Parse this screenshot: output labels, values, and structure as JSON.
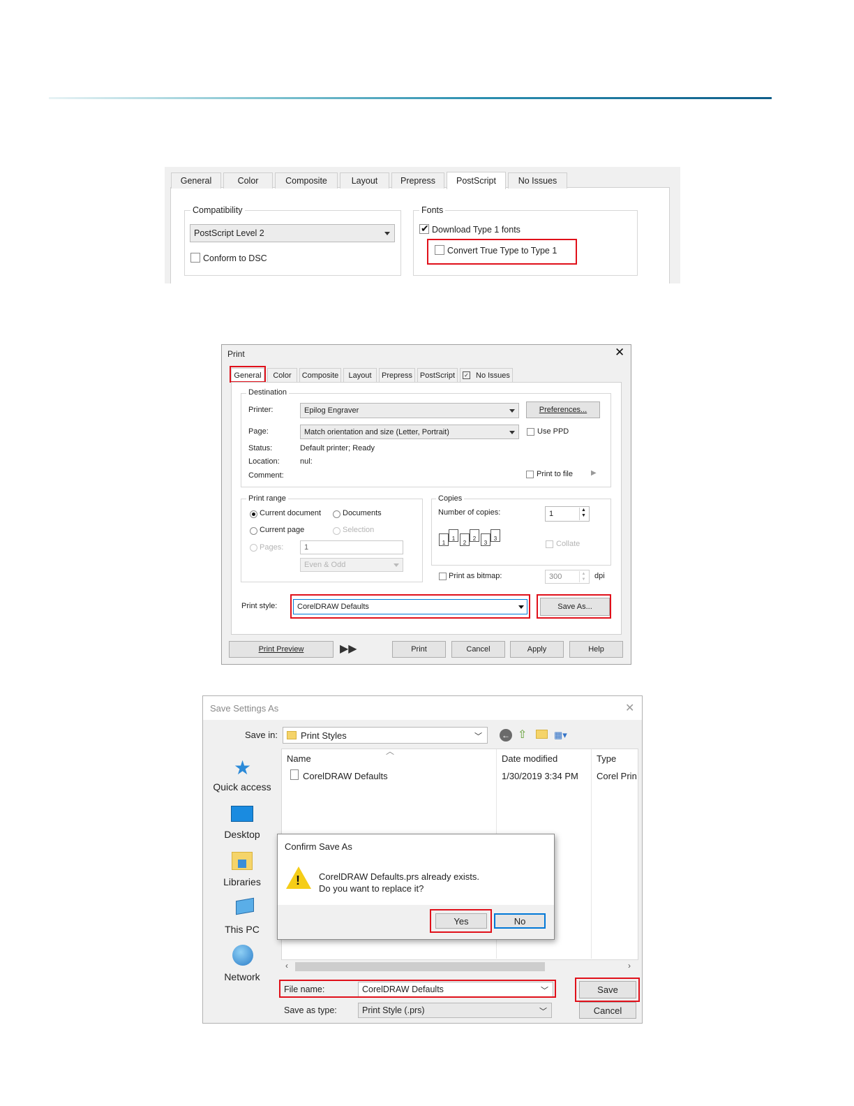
{
  "colors": {
    "highlight": "#e0101a",
    "accent_line": "#0f5e8a",
    "selection_blue": "#0078d7"
  },
  "panel1": {
    "tabs": [
      "General",
      "Color",
      "Composite",
      "Layout",
      "Prepress",
      "PostScript",
      "No Issues"
    ],
    "compatibility": {
      "label": "Compatibility",
      "level": "PostScript Level 2",
      "conform_dsc": "Conform to DSC"
    },
    "fonts": {
      "label": "Fonts",
      "download_type1": "Download Type 1 fonts",
      "download_checked": true,
      "convert_truetype": "Convert True Type to Type 1",
      "convert_checked": false
    }
  },
  "print_dialog": {
    "title": "Print",
    "tabs": [
      "General",
      "Color",
      "Composite",
      "Layout",
      "Prepress",
      "PostScript",
      "No Issues"
    ],
    "destination": {
      "label": "Destination",
      "printer_label": "Printer:",
      "printer": "Epilog Engraver",
      "preferences": "Preferences...",
      "page_label": "Page:",
      "page": "Match orientation and size (Letter, Portrait)",
      "use_ppd": "Use PPD",
      "status_label": "Status:",
      "status": "Default printer; Ready",
      "location_label": "Location:",
      "location": "nul:",
      "comment_label": "Comment:",
      "print_to_file": "Print to file"
    },
    "print_range": {
      "label": "Print range",
      "current_document": "Current document",
      "documents": "Documents",
      "current_page": "Current page",
      "selection": "Selection",
      "pages_label": "Pages:",
      "pages_value": "1",
      "even_odd": "Even & Odd"
    },
    "copies": {
      "label": "Copies",
      "number_label": "Number of copies:",
      "number": "1",
      "collate": "Collate",
      "page_icons": [
        "1",
        "1",
        "2",
        "2",
        "3",
        "3"
      ]
    },
    "print_as_bitmap": "Print as bitmap:",
    "dpi_value": "300",
    "dpi_unit": "dpi",
    "print_style_label": "Print style:",
    "print_style": "CorelDRAW Defaults",
    "save_as": "Save As...",
    "buttons": {
      "preview": "Print Preview",
      "print": "Print",
      "cancel": "Cancel",
      "apply": "Apply",
      "help": "Help"
    }
  },
  "save_dialog": {
    "title": "Save Settings As",
    "save_in_label": "Save in:",
    "save_in": "Print Styles",
    "sidebar": [
      "Quick access",
      "Desktop",
      "Libraries",
      "This PC",
      "Network"
    ],
    "columns": {
      "name": "Name",
      "date": "Date modified",
      "type": "Type"
    },
    "files": [
      {
        "name": "CorelDRAW Defaults",
        "date": "1/30/2019 3:34 PM",
        "type": "Corel Prin"
      }
    ],
    "file_name_label": "File name:",
    "file_name": "CorelDRAW Defaults",
    "save_type_label": "Save as type:",
    "save_type": "Print Style (.prs)",
    "save": "Save",
    "cancel": "Cancel"
  },
  "confirm": {
    "title": "Confirm Save As",
    "line1": "CorelDRAW Defaults.prs already exists.",
    "line2": "Do you want to replace it?",
    "yes": "Yes",
    "no": "No"
  }
}
